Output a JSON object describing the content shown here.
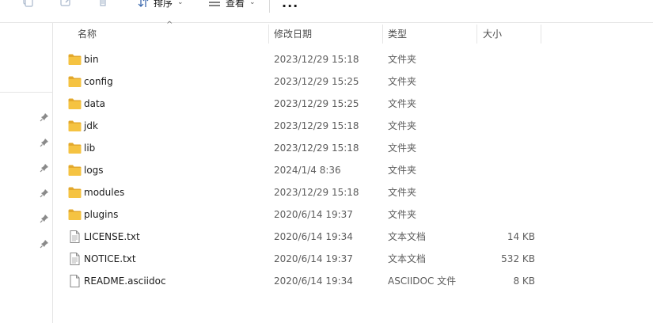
{
  "toolbar": {
    "sort_label": "排序",
    "view_label": "查看",
    "more_label": "..."
  },
  "columns": {
    "name": "名称",
    "date": "修改日期",
    "type": "类型",
    "size": "大小"
  },
  "files": [
    {
      "name": "bin",
      "date": "2023/12/29 15:18",
      "type": "文件夹",
      "size": "",
      "icon": "folder-icon"
    },
    {
      "name": "config",
      "date": "2023/12/29 15:25",
      "type": "文件夹",
      "size": "",
      "icon": "folder-icon"
    },
    {
      "name": "data",
      "date": "2023/12/29 15:25",
      "type": "文件夹",
      "size": "",
      "icon": "folder-icon"
    },
    {
      "name": "jdk",
      "date": "2023/12/29 15:18",
      "type": "文件夹",
      "size": "",
      "icon": "folder-icon"
    },
    {
      "name": "lib",
      "date": "2023/12/29 15:18",
      "type": "文件夹",
      "size": "",
      "icon": "folder-icon"
    },
    {
      "name": "logs",
      "date": "2024/1/4 8:36",
      "type": "文件夹",
      "size": "",
      "icon": "folder-icon"
    },
    {
      "name": "modules",
      "date": "2023/12/29 15:18",
      "type": "文件夹",
      "size": "",
      "icon": "folder-icon"
    },
    {
      "name": "plugins",
      "date": "2020/6/14 19:37",
      "type": "文件夹",
      "size": "",
      "icon": "folder-icon"
    },
    {
      "name": "LICENSE.txt",
      "date": "2020/6/14 19:34",
      "type": "文本文档",
      "size": "14 KB",
      "icon": "text-file-icon"
    },
    {
      "name": "NOTICE.txt",
      "date": "2020/6/14 19:37",
      "type": "文本文档",
      "size": "532 KB",
      "icon": "text-file-icon"
    },
    {
      "name": "README.asciidoc",
      "date": "2020/6/14 19:34",
      "type": "ASCIIDOC 文件",
      "size": "8 KB",
      "icon": "blank-file-icon"
    }
  ],
  "colors": {
    "folder": "#f5c342",
    "folder_dark": "#e3a82b",
    "header_text": "#4b4b4b",
    "divider": "#e5e5e5"
  }
}
